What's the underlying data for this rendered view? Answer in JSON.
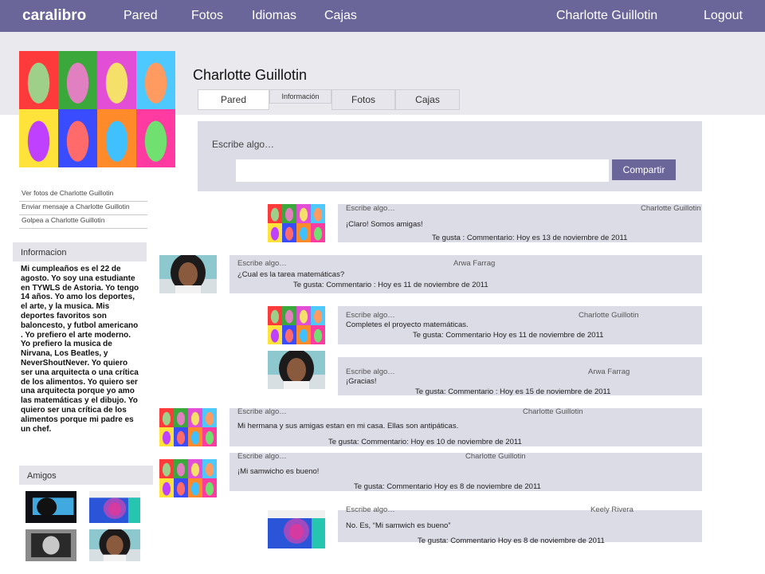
{
  "header": {
    "brand": "caralibro",
    "nav": [
      "Pared",
      "Fotos",
      "Idiomas",
      "Cajas"
    ],
    "user": "Charlotte Guillotin",
    "logout": "Logout"
  },
  "profile": {
    "name": "Charlotte Guillotin",
    "tabs": [
      "Pared",
      "Información",
      "Fotos",
      "Cajas"
    ]
  },
  "sidebar": {
    "links": [
      "Ver fotos de Charlotte Guillotin",
      "Enviar mensaje a Charlotte Guillotin",
      "Golpea  a Charlotte Guillotin"
    ],
    "info_title": "Informacion",
    "bio": "Mi cumpleaños es el 22 de agosto. Yo soy una estudiante en TYWLS de Astoria. Yo tengo 14 años. Yo amo los deportes, el arte, y la musica. Mis deportes favoritos  son baloncesto, y futbol americano . Yo prefiero el arte moderno. Yo prefiero la musica de Nirvana, Los Beatles, y NeverShoutNever. Yo quiero ser una arquitecta o una crítica de los alimentos. Yo quiero ser una arquitecta porque yo amo las matemáticas y el dibujo. Yo quiero ser una crítica de los alimentos porque mi padre es un chef.",
    "friends_title": "Amigos"
  },
  "composer": {
    "label": "Escribe algo…",
    "button": "Compartir"
  },
  "posts": [
    {
      "header": "Escribe algo…",
      "author": "Charlotte Guillotin",
      "text": "¡Claro! Somos amigas!",
      "meta": "Te gusta : Commentario: Hoy es 13 de noviembre de 2011"
    },
    {
      "header": "Escribe algo…",
      "author": "Arwa Farrag",
      "text": "¿Cual es la tarea matemáticas?",
      "meta": "Te gusta:  Commentario  :     Hoy es 11 de noviembre de 2011"
    },
    {
      "header": "Escribe algo…",
      "author": "Charlotte Guillotin",
      "text": "Completes el proyecto matemáticas.",
      "meta": "Te gusta:     Commentario    Hoy es 11 de noviembre de 2011"
    },
    {
      "header": "Escribe algo…",
      "author": "Arwa Farrag",
      "text": "¡Gracias!",
      "meta": "Te gusta: Commentario :    Hoy es 15 de noviembre de 2011"
    },
    {
      "header": "Escribe algo…",
      "author": "Charlotte Guillotin",
      "text": "Mi hermana y sus amigas estan en mi casa. Ellas son antipáticas.",
      "meta": "Te gusta:      Commentario:          Hoy es 10 de noviembre de 2011"
    },
    {
      "header": "Escribe algo…",
      "author": "Charlotte Guillotin",
      "text": "¡Mi samwicho es bueno!",
      "meta": "Te gusta: Commentario      Hoy es 8 de noviembre de 2011"
    },
    {
      "header": "Escribe algo…",
      "author": "Keely Rivera",
      "text": "No. Es, “Mi samwich es bueno”",
      "meta": "Te gusta: Commentario     Hoy es 8 de noviembre de 2011"
    }
  ]
}
